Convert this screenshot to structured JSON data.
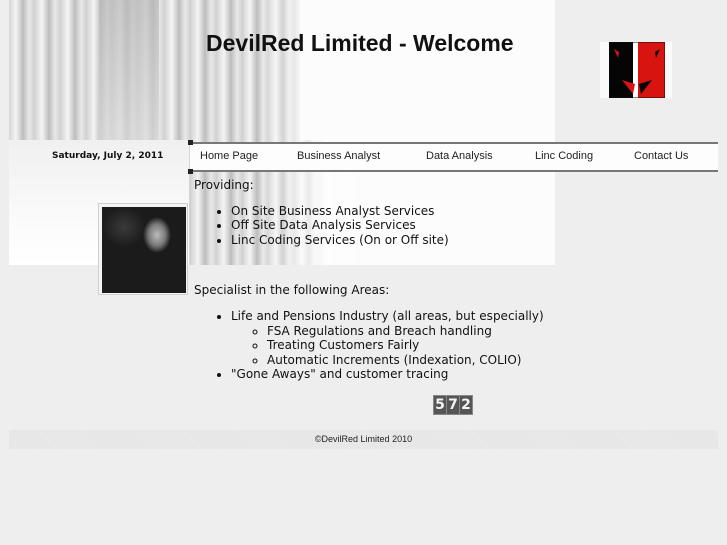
{
  "header": {
    "title": "DevilRed Limited - Welcome",
    "date": "Saturday, July 2, 2011",
    "logo_icon": "devil-face-logo-icon",
    "brand_colors": {
      "red": "#d7140f",
      "black": "#050505"
    }
  },
  "nav": {
    "items": [
      {
        "label": "Home Page"
      },
      {
        "label": "Business Analyst"
      },
      {
        "label": "Data Analysis"
      },
      {
        "label": "Linc Coding"
      },
      {
        "label": "Contact Us"
      }
    ]
  },
  "content": {
    "providing_heading": "Providing:",
    "providing_items": [
      "On Site Business Analyst Services",
      "Off Site Data Analysis Services",
      "Linc Coding Services (On or Off site)"
    ],
    "specialist_heading": "Specialist in the following Areas:",
    "specialist_items": [
      {
        "label": "Life and Pensions Industry (all areas, but especially)",
        "subitems": [
          "FSA Regulations and Breach handling",
          "Treating Customers Fairly",
          "Automatic Increments (Indexation, COLIO)"
        ]
      },
      {
        "label": "\"Gone Aways\" and customer tracing"
      }
    ]
  },
  "counter": {
    "digits": [
      "5",
      "7",
      "2"
    ]
  },
  "footer": {
    "copyright": "©DevilRed Limited 2010"
  }
}
